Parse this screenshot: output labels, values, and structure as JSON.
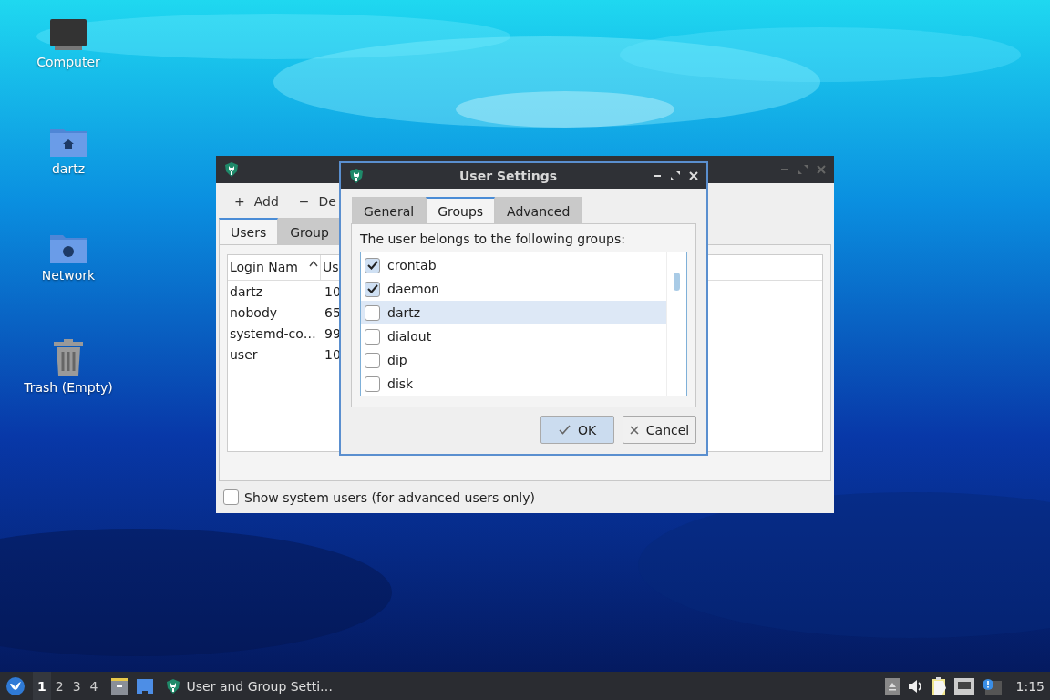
{
  "desktop_icons": [
    {
      "label": "Computer",
      "kind": "computer"
    },
    {
      "label": "dartz",
      "kind": "home"
    },
    {
      "label": "Network",
      "kind": "network"
    },
    {
      "label": "Trash (Empty)",
      "kind": "trash"
    }
  ],
  "main_window": {
    "toolbar": [
      {
        "icon": "+",
        "label": "Add"
      },
      {
        "icon": "−",
        "label": "De"
      }
    ],
    "tabs": [
      {
        "label": "Users",
        "selected": true
      },
      {
        "label": "Group",
        "selected": false
      }
    ],
    "table": {
      "columns": [
        {
          "label": "Login Nam",
          "sorted": true
        },
        {
          "label": "Us"
        }
      ],
      "rows": [
        [
          "dartz",
          "10"
        ],
        [
          "nobody",
          "65"
        ],
        [
          "systemd-co…",
          "99"
        ],
        [
          "user",
          "10"
        ]
      ]
    },
    "show_system_users": {
      "label": "Show system users (for advanced users only)",
      "checked": false
    }
  },
  "dialog": {
    "title": "User Settings",
    "tabs": [
      {
        "label": "General",
        "selected": false
      },
      {
        "label": "Groups",
        "selected": true
      },
      {
        "label": "Advanced",
        "selected": false
      }
    ],
    "prompt": "The user belongs to the following groups:",
    "groups": [
      {
        "name": "crontab",
        "checked": true,
        "selected": false
      },
      {
        "name": "daemon",
        "checked": true,
        "selected": false
      },
      {
        "name": "dartz",
        "checked": false,
        "selected": true
      },
      {
        "name": "dialout",
        "checked": false,
        "selected": false
      },
      {
        "name": "dip",
        "checked": false,
        "selected": false
      },
      {
        "name": "disk",
        "checked": false,
        "selected": false
      }
    ],
    "buttons": [
      {
        "kind": "ok",
        "label": "OK"
      },
      {
        "kind": "cancel",
        "label": "Cancel"
      }
    ]
  },
  "taskbar": {
    "workspaces": [
      {
        "label": "1",
        "selected": true
      },
      {
        "label": "2",
        "selected": false
      },
      {
        "label": "3",
        "selected": false
      },
      {
        "label": "4",
        "selected": false
      }
    ],
    "task": {
      "label": "User and Group Setti…"
    },
    "clock": "1:15"
  }
}
